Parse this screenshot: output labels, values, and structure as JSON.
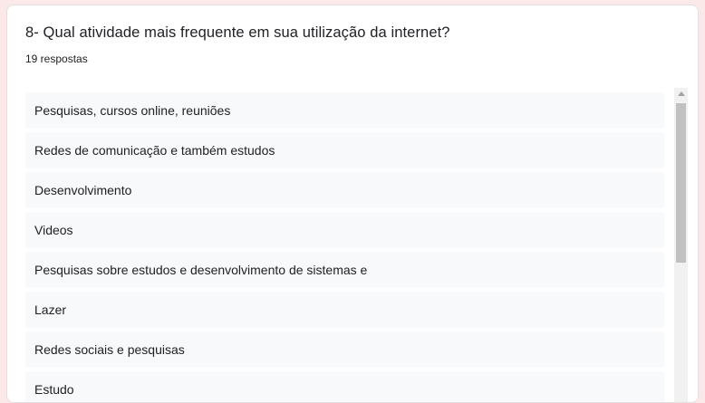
{
  "question": {
    "title": "8- Qual atividade mais frequente em sua utilização da internet?",
    "response_count": "19 respostas"
  },
  "responses": [
    "Pesquisas, cursos online, reuniões",
    "Redes de comunicação e também estudos",
    "Desenvolvimento",
    "Videos",
    "Pesquisas sobre estudos e desenvolvimento de sistemas e",
    "Lazer",
    "Redes sociais e pesquisas",
    "Estudo"
  ],
  "scrollbar": {
    "up_icon": "chevron-up-icon"
  }
}
